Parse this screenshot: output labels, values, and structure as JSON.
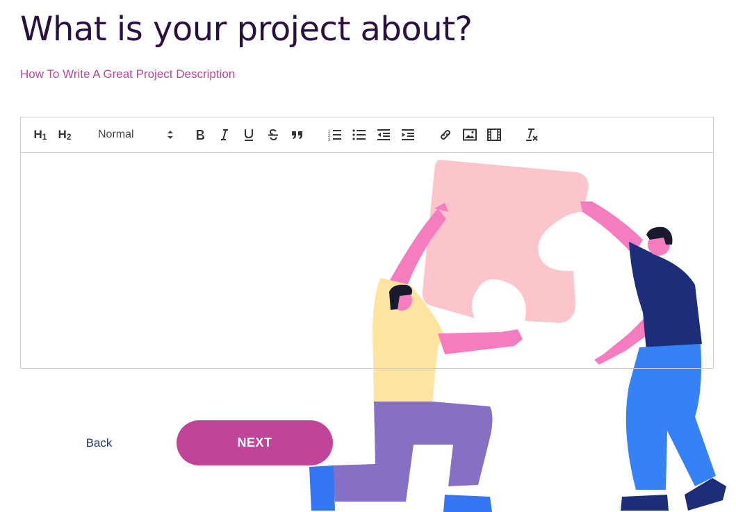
{
  "page": {
    "title": "What is your project about?",
    "help_link": "How To Write A Great Project Description"
  },
  "toolbar": {
    "h1": "H",
    "h1_sub": "1",
    "h2": "H",
    "h2_sub": "2",
    "format_value": "Normal",
    "icons": [
      "bold-icon",
      "italic-icon",
      "underline-icon",
      "strike-icon",
      "quote-icon",
      "ordered-list-icon",
      "bullet-list-icon",
      "outdent-icon",
      "indent-icon",
      "link-icon",
      "image-icon",
      "video-icon",
      "clear-format-icon"
    ]
  },
  "editor": {
    "content": ""
  },
  "actions": {
    "back_label": "Back",
    "next_label": "NEXT"
  },
  "colors": {
    "accent": "#c0449a",
    "title": "#2a1040",
    "back": "#2a3a6b"
  }
}
